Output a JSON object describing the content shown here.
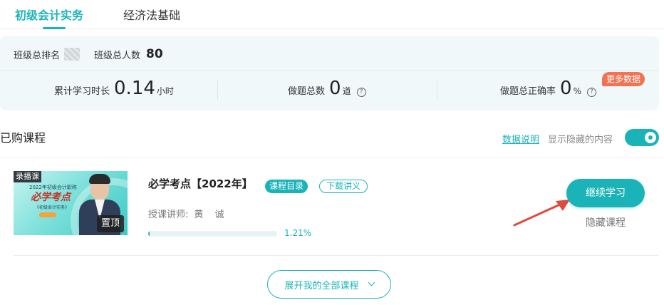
{
  "tabs": [
    {
      "label": "初级会计实务",
      "active": true
    },
    {
      "label": "经济法基础",
      "active": false
    }
  ],
  "stats": {
    "rank_label": "班级总排名",
    "total_label": "班级总人数",
    "total_value": "80",
    "study_time_label": "累计学习时长",
    "study_time_value": "0.14",
    "study_time_unit": "小时",
    "questions_label": "做题总数",
    "questions_value": "0",
    "questions_unit": "道",
    "accuracy_label": "做题总正确率",
    "accuracy_value": "0",
    "accuracy_unit": "%",
    "more_badge": "更多数据",
    "help_glyph": "?"
  },
  "purchased": {
    "title": "已购课程",
    "data_link": "数据说明",
    "show_hidden_label": "显示隐藏的内容",
    "show_hidden_on": true
  },
  "course": {
    "thumb_tag": "录播课",
    "thumb_small": "2022年初级会计职称",
    "thumb_big": "必学考点",
    "thumb_sub": "《初级会计实务》",
    "pin_label": "置顶",
    "title": "必学考点【2022年】",
    "catalog_label": "课程目录",
    "download_label": "下载讲义",
    "teacher_label": "授课讲师:",
    "teacher_name": "黄 诚",
    "progress_percent": 1.21,
    "progress_text": "1.21%",
    "continue_label": "继续学习",
    "hide_label": "隐藏课程"
  },
  "expand_label": "展开我的全部课程",
  "colors": {
    "accent": "#1ab3b8",
    "badge": "#f27253",
    "arrow": "#e04a3f"
  }
}
